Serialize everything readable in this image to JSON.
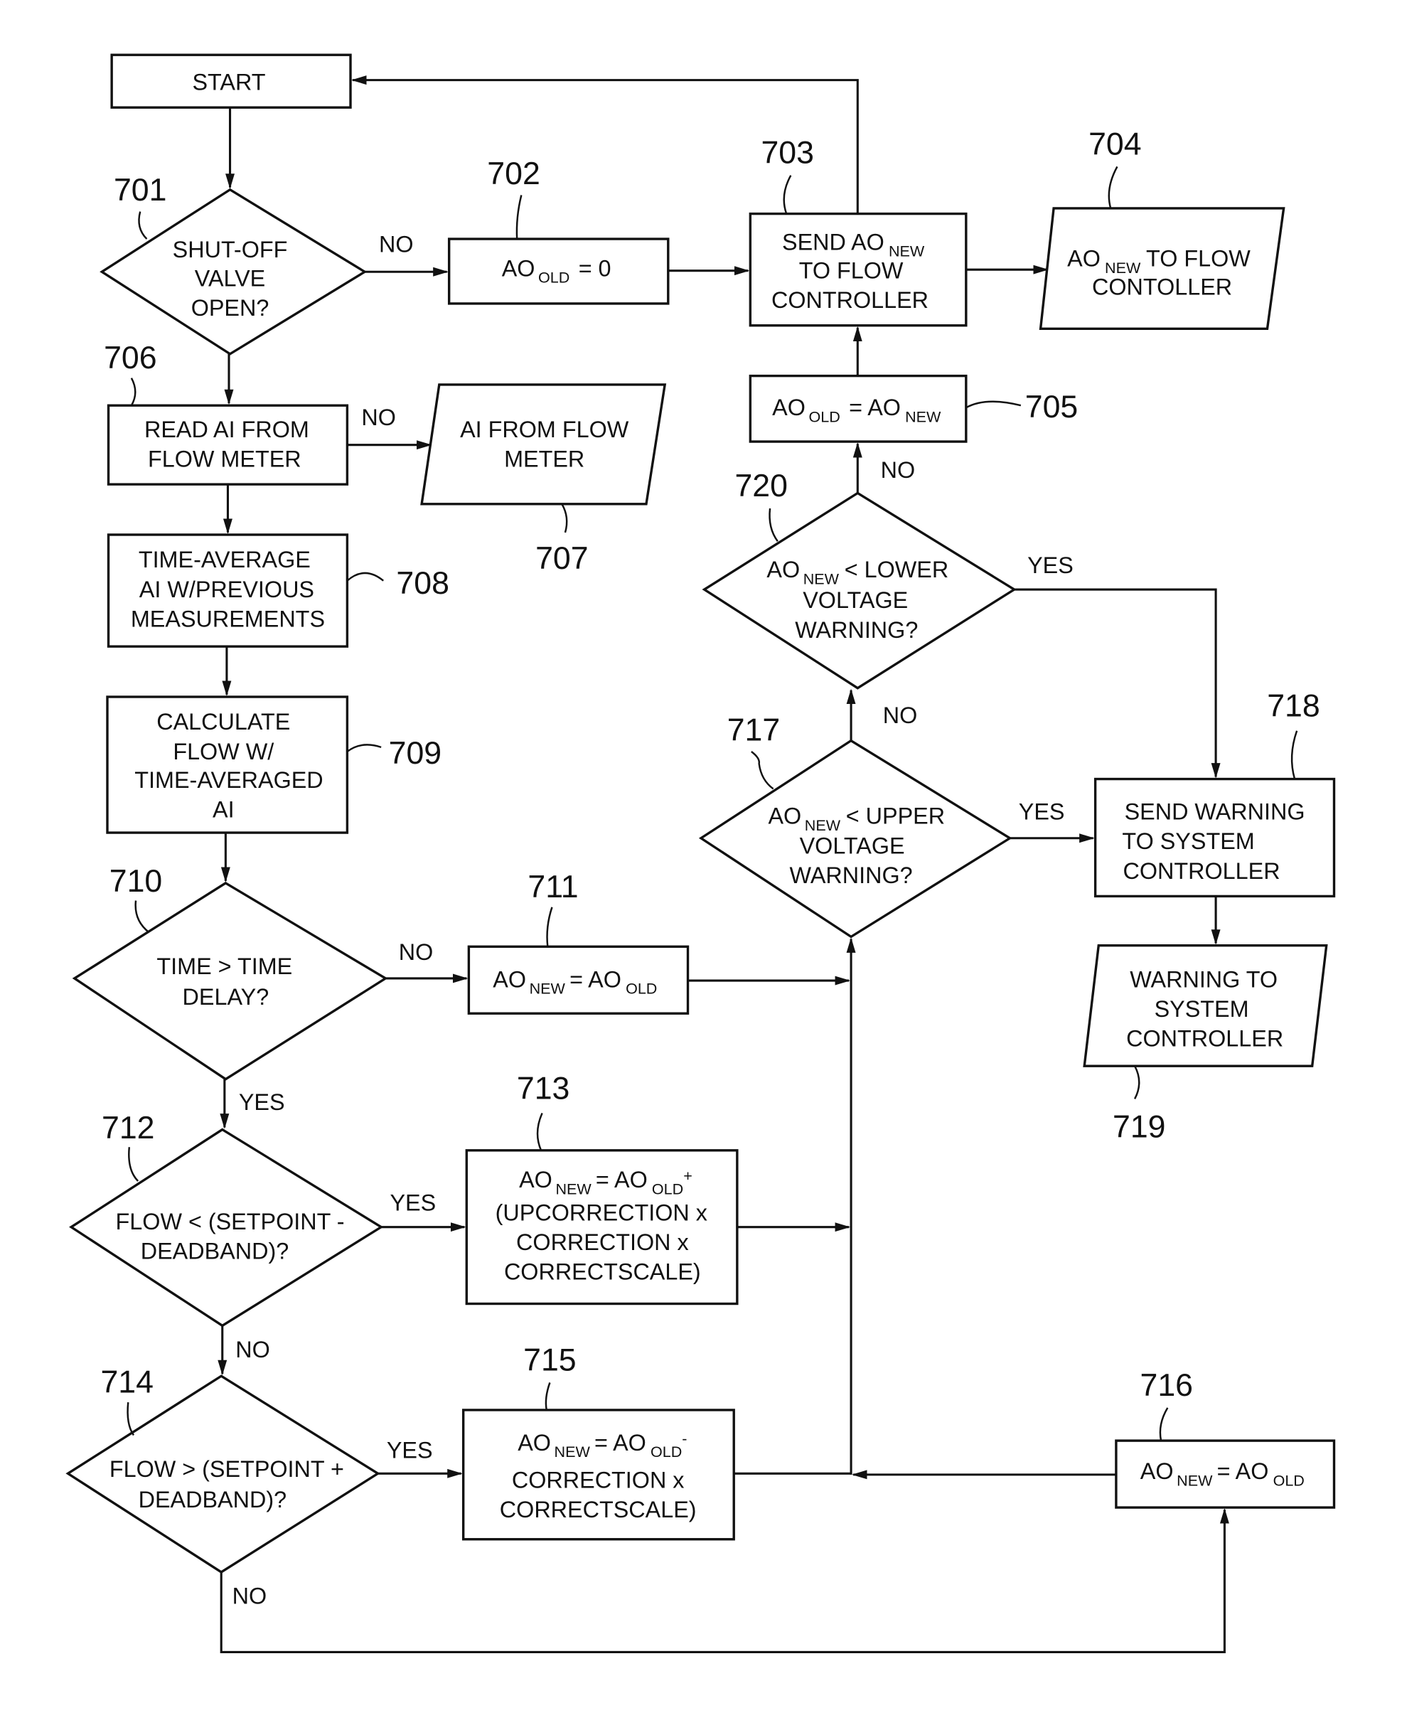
{
  "figure": {
    "type": "flowchart",
    "colors": {
      "ink": "#111111",
      "background": "#ffffff"
    }
  },
  "nodes": {
    "start": {
      "ref": "",
      "kind": "terminal",
      "lines": [
        "START"
      ]
    },
    "n701": {
      "ref": "701",
      "kind": "decision",
      "lines": [
        "SHUT-OFF",
        "VALVE",
        "OPEN?"
      ]
    },
    "n702": {
      "ref": "702",
      "kind": "process",
      "text": {
        "a": "AO",
        "a_sub": "OLD",
        "b": "= 0"
      }
    },
    "n703": {
      "ref": "703",
      "kind": "process",
      "line1": {
        "a": "SEND AO",
        "a_sub": "NEW"
      },
      "lines": [
        "TO FLOW",
        "CONTROLLER"
      ]
    },
    "n704": {
      "ref": "704",
      "kind": "io",
      "line1": {
        "a": "AO",
        "a_sub": "NEW",
        "b": "TO FLOW"
      },
      "lines": [
        "CONTOLLER"
      ]
    },
    "n705": {
      "ref": "705",
      "kind": "process",
      "text": {
        "a": "AO",
        "a_sub": "OLD",
        "b": "= AO",
        "b_sub": "NEW"
      }
    },
    "n706": {
      "ref": "706",
      "kind": "process",
      "lines": [
        "READ AI FROM",
        "FLOW METER"
      ]
    },
    "n707": {
      "ref": "707",
      "kind": "io",
      "lines": [
        "AI FROM FLOW",
        "METER"
      ]
    },
    "n708": {
      "ref": "708",
      "kind": "process",
      "lines": [
        "TIME-AVERAGE",
        "AI W/PREVIOUS",
        "MEASUREMENTS"
      ]
    },
    "n709": {
      "ref": "709",
      "kind": "process",
      "lines": [
        "CALCULATE",
        "FLOW W/",
        "TIME-AVERAGED",
        "AI"
      ]
    },
    "n710": {
      "ref": "710",
      "kind": "decision",
      "lines": [
        "TIME > TIME",
        "DELAY?"
      ]
    },
    "n711": {
      "ref": "711",
      "kind": "process",
      "text": {
        "a": "AO",
        "a_sub": "NEW",
        "b": "= AO",
        "b_sub": "OLD"
      }
    },
    "n712": {
      "ref": "712",
      "kind": "decision",
      "lines": [
        "FLOW < (SETPOINT -",
        "DEADBAND)?"
      ]
    },
    "n713": {
      "ref": "713",
      "kind": "process",
      "line1": {
        "a": "AO",
        "a_sub": "NEW",
        "b": "= AO",
        "b_sub": "OLD",
        "c": "+"
      },
      "lines": [
        "(UPCORRECTION x",
        "CORRECTION  x",
        "CORRECTSCALE)"
      ]
    },
    "n714": {
      "ref": "714",
      "kind": "decision",
      "lines": [
        "FLOW > (SETPOINT +",
        "DEADBAND)?"
      ]
    },
    "n715": {
      "ref": "715",
      "kind": "process",
      "line1": {
        "a": "AO",
        "a_sub": "NEW",
        "b": "= AO",
        "b_sub": "OLD",
        "c": "-"
      },
      "lines": [
        "CORRECTION  x",
        "CORRECTSCALE)"
      ]
    },
    "n716": {
      "ref": "716",
      "kind": "process",
      "text": {
        "a": "AO",
        "a_sub": "NEW",
        "b": "= AO",
        "b_sub": "OLD"
      }
    },
    "n717": {
      "ref": "717",
      "kind": "decision",
      "line1": {
        "a": "AO",
        "a_sub": "NEW",
        "b": "< UPPER"
      },
      "lines": [
        "VOLTAGE",
        "WARNING?"
      ]
    },
    "n718": {
      "ref": "718",
      "kind": "process",
      "lines": [
        "SEND WARNING",
        "TO SYSTEM",
        "CONTROLLER"
      ]
    },
    "n719": {
      "ref": "719",
      "kind": "io",
      "lines": [
        "WARNING TO",
        "SYSTEM",
        "CONTROLLER"
      ]
    },
    "n720": {
      "ref": "720",
      "kind": "decision",
      "line1": {
        "a": "AO",
        "a_sub": "NEW",
        "b": "< LOWER"
      },
      "lines": [
        "VOLTAGE",
        "WARNING?"
      ]
    }
  },
  "edge_labels": {
    "e701_no": "NO",
    "e706_no": "NO",
    "e720_no": "NO",
    "e720_yes": "YES",
    "e717_no": "NO",
    "e717_yes": "YES",
    "e710_no": "NO",
    "e710_yes": "YES",
    "e712_yes": "YES",
    "e712_no": "NO",
    "e714_yes": "YES",
    "e714_no": "NO"
  }
}
